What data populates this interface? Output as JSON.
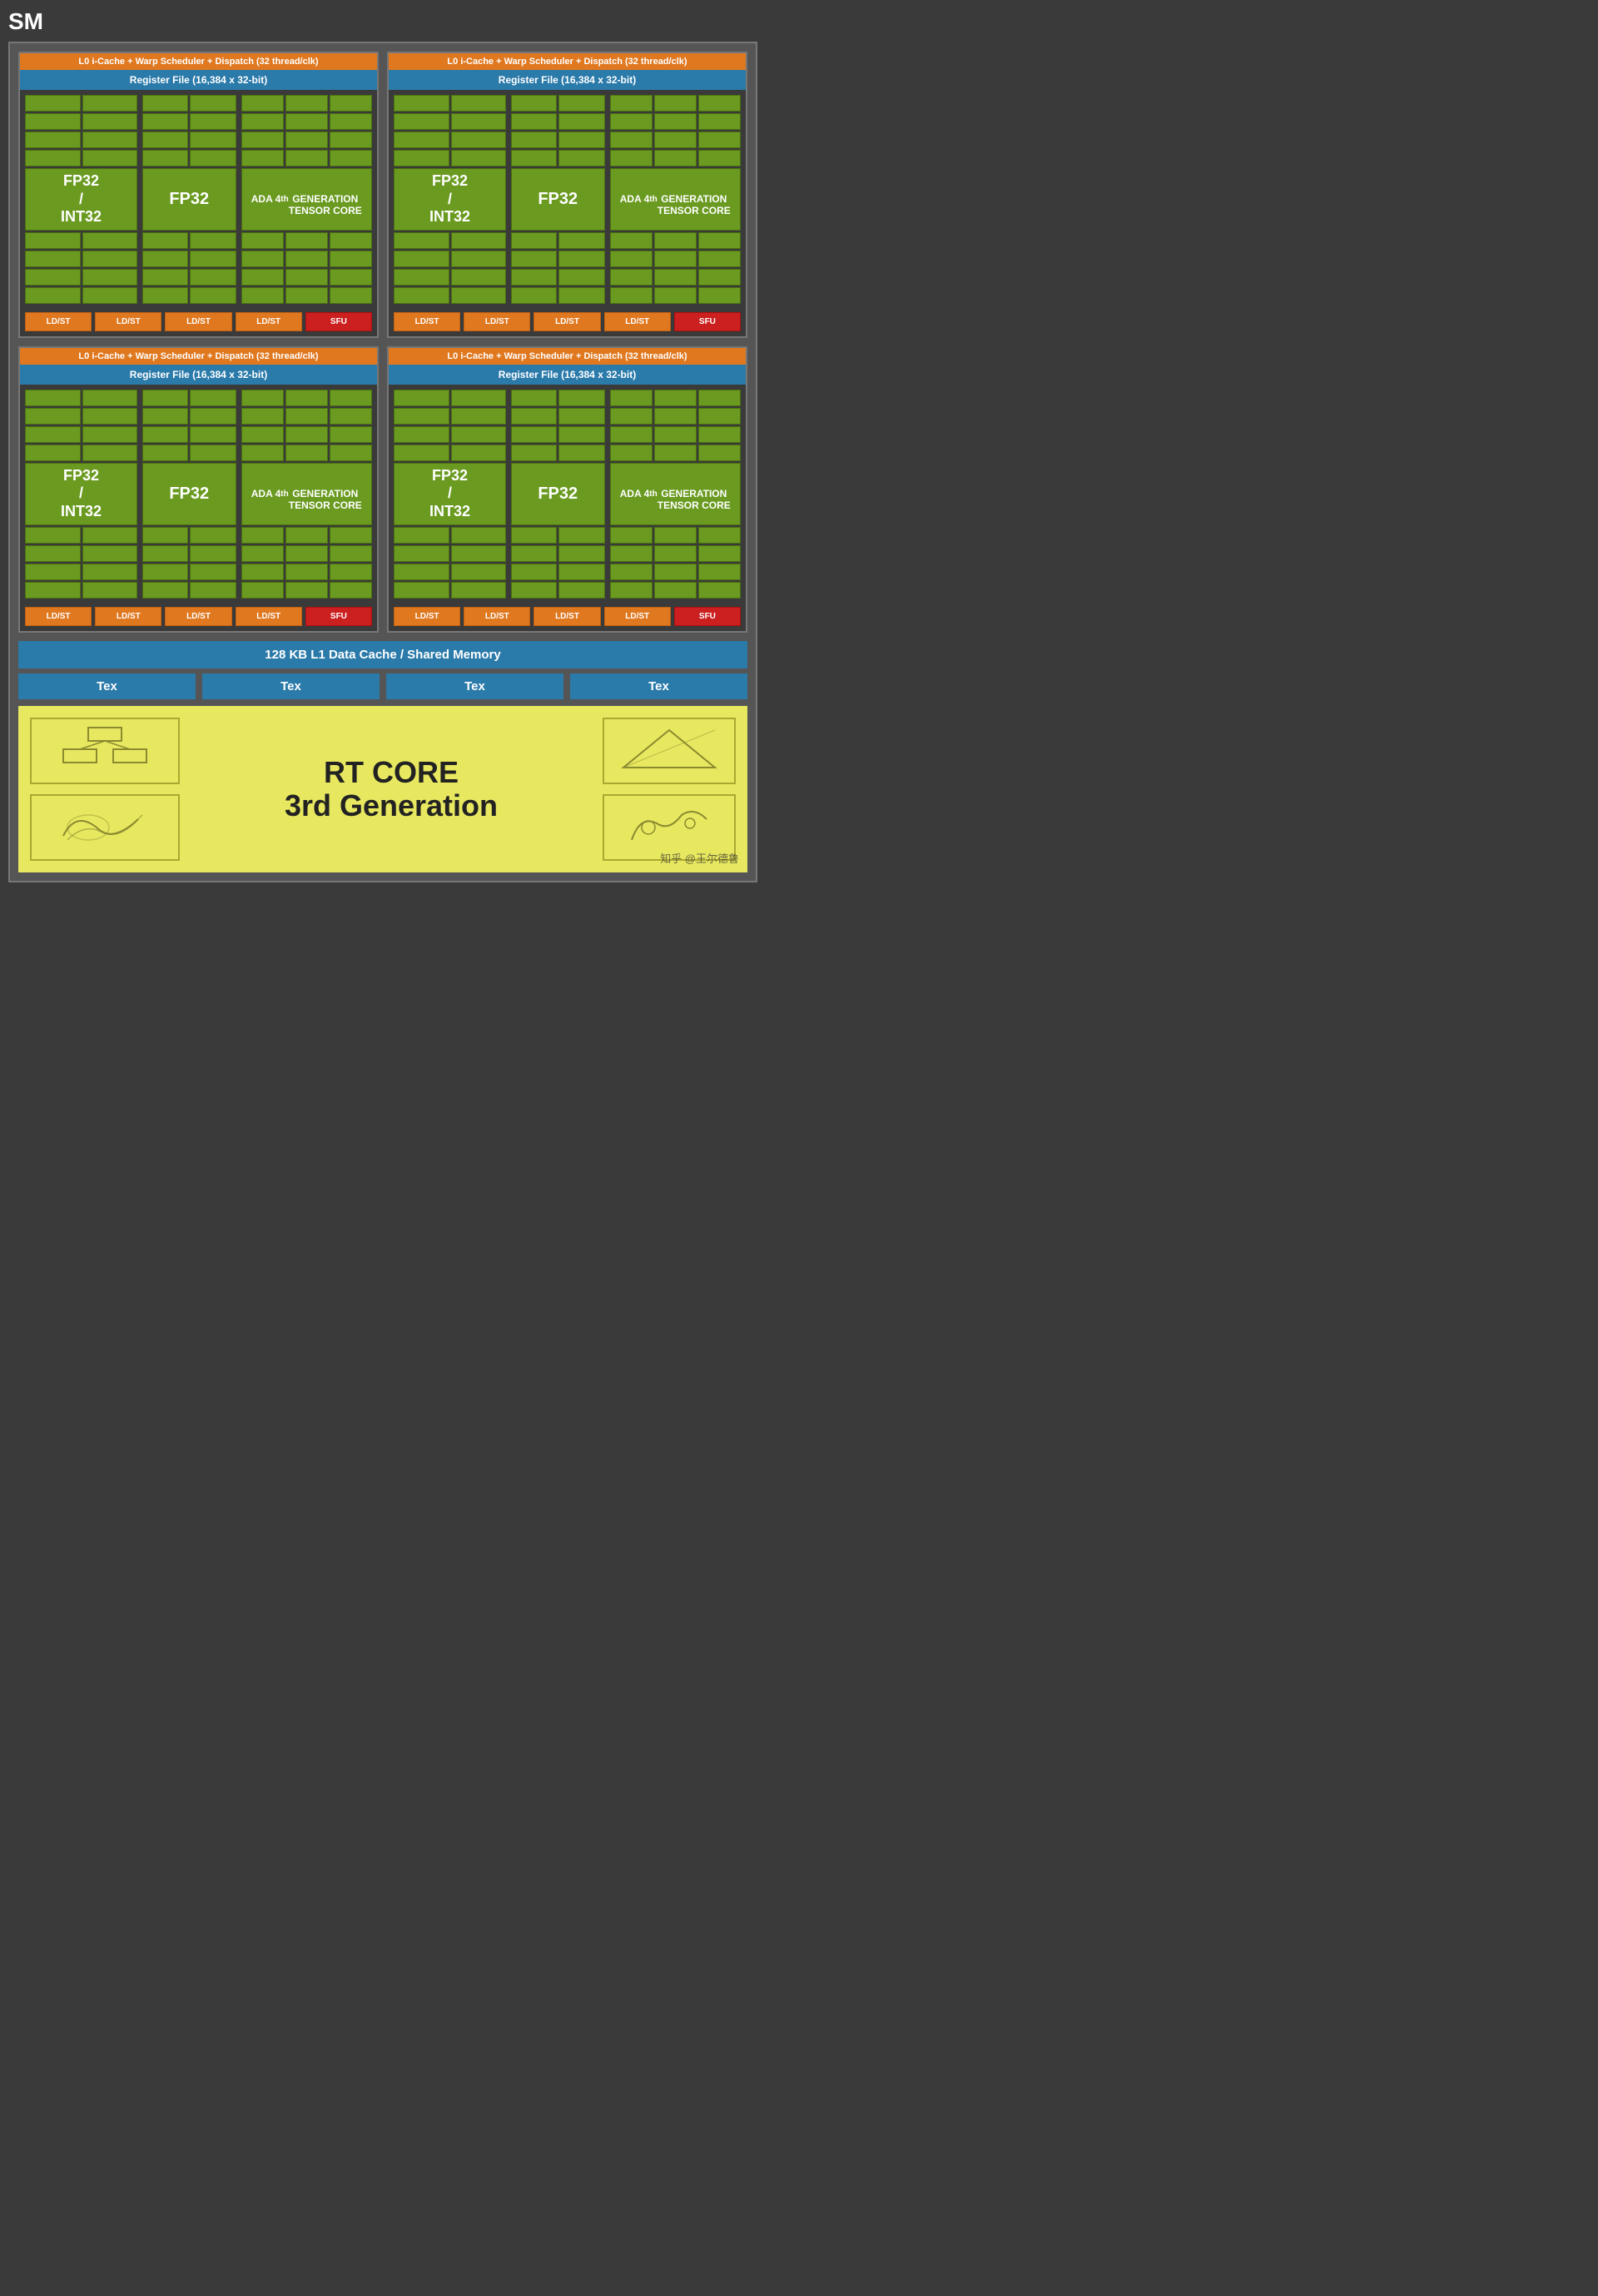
{
  "title": "SM",
  "warp_scheduler": "L0 i-Cache + Warp Scheduler + Dispatch (32 thread/clk)",
  "register_file": "Register File (16,384 x 32-bit)",
  "fp32_int32_label": "FP32\n/\nINT32",
  "fp32_label": "FP32",
  "tensor_label_line1": "ADA 4",
  "tensor_label_sup": "th",
  "tensor_label_line2": "GENERATION\nTENSOR CORE",
  "ldst_labels": [
    "LD/ST",
    "LD/ST",
    "LD/ST",
    "LD/ST"
  ],
  "sfu_label": "SFU",
  "l1_cache": "128 KB L1 Data Cache / Shared Memory",
  "tex_labels": [
    "Tex",
    "Tex",
    "Tex",
    "Tex"
  ],
  "rt_core_title": "RT CORE\n3rd Generation",
  "watermark": "知乎 @王尔德鲁",
  "colors": {
    "orange": "#e07820",
    "blue": "#2a7aaa",
    "green": "#6a9a20",
    "red": "#cc2020",
    "yellow_bg": "#e8e860",
    "dark_bg": "#3a3a3a"
  }
}
